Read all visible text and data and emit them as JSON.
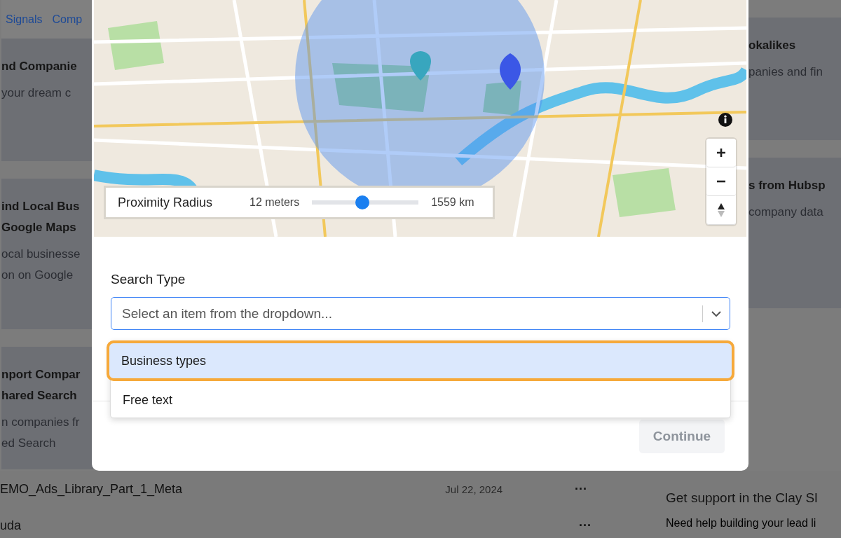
{
  "background": {
    "tabs": [
      {
        "label": "Signals"
      },
      {
        "label": "Comp"
      }
    ],
    "left_cards": [
      {
        "title_lines": [
          "nd Companie"
        ],
        "desc_lines": [
          "your dream c"
        ]
      },
      {
        "title_lines": [
          "ind Local Bus",
          "Google Maps"
        ],
        "desc_lines": [
          "ocal businesse",
          "on on Google"
        ]
      },
      {
        "title_lines": [
          "nport Compar",
          "hared Search"
        ],
        "desc_lines": [
          "n companies fr",
          "ed Search"
        ]
      }
    ],
    "right_cards": [
      {
        "title_lines": [
          "okalikes"
        ],
        "desc_lines": [
          "panies and fin"
        ]
      },
      {
        "title_lines": [
          "s from Hubsp"
        ],
        "desc_lines": [
          "company data"
        ]
      }
    ],
    "table_rows": [
      {
        "name": "EMO_Ads_Library_Part_1_Meta",
        "date": "Jul 22, 2024",
        "menu": "···"
      },
      {
        "name": "uda",
        "menu": "···"
      }
    ],
    "support": {
      "title": "Get support in the Clay Sl",
      "text": "Need help building your lead li"
    }
  },
  "modal": {
    "map": {
      "proximity": {
        "label": "Proximity Radius",
        "min": "12 meters",
        "max": "1559 km",
        "level": 0.47
      }
    },
    "search_type": {
      "label": "Search Type",
      "placeholder": "Select an item from the dropdown...",
      "options": [
        {
          "label": "Business types",
          "selected": true
        },
        {
          "label": "Free text",
          "selected": false
        }
      ]
    },
    "continue": {
      "label": "Continue",
      "disabled": true
    }
  }
}
